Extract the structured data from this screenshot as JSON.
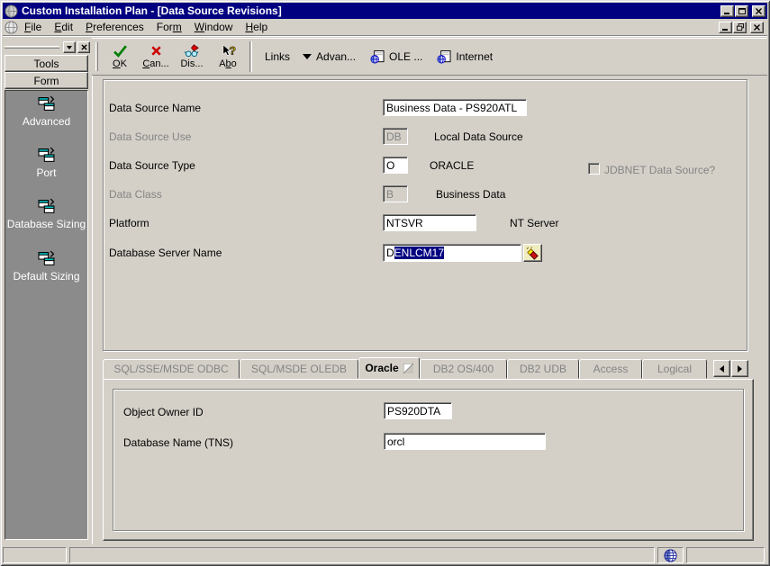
{
  "window": {
    "title": "Custom Installation Plan - [Data Source Revisions]"
  },
  "menu": {
    "items": [
      {
        "pre": "",
        "key": "F",
        "post": "ile"
      },
      {
        "pre": "",
        "key": "E",
        "post": "dit"
      },
      {
        "pre": "",
        "key": "P",
        "post": "references"
      },
      {
        "pre": "For",
        "key": "m",
        "post": ""
      },
      {
        "pre": "",
        "key": "W",
        "post": "indow"
      },
      {
        "pre": "",
        "key": "H",
        "post": "elp"
      }
    ]
  },
  "toolbar": {
    "ok": {
      "pre": "",
      "key": "O",
      "post": "K"
    },
    "cancel": {
      "pre": "",
      "key": "C",
      "post": "an..."
    },
    "display": {
      "pre": "Dis...",
      "key": "",
      "post": ""
    },
    "about": {
      "pre": "A",
      "key": "b",
      "post": "o"
    },
    "links_label": "Links",
    "advanced_label": "Advan...",
    "ole_label": "OLE ...",
    "internet_label": "Internet"
  },
  "sidebar": {
    "tabs": [
      {
        "label": "Tools"
      },
      {
        "label": "Form"
      }
    ],
    "items": [
      {
        "label": "Advanced"
      },
      {
        "label": "Port"
      },
      {
        "label": "Database Sizing"
      },
      {
        "label": "Default Sizing"
      }
    ]
  },
  "form": {
    "data_source_name": {
      "label": "Data Source Name",
      "value": "Business Data - PS920ATL"
    },
    "data_source_use": {
      "label": "Data Source Use",
      "value": "DB",
      "desc": "Local Data Source",
      "disabled": true
    },
    "data_source_type": {
      "label": "Data Source Type",
      "value": "O",
      "desc": "ORACLE"
    },
    "jdbnet": {
      "label": "JDBNET Data Source?",
      "checked": false
    },
    "data_class": {
      "label": "Data Class",
      "value": "B",
      "desc": "Business Data",
      "disabled": true
    },
    "platform": {
      "label": "Platform",
      "value": "NTSVR",
      "desc": "NT Server"
    },
    "database_server": {
      "label": "Database Server Name",
      "value": "DENLCM17",
      "unselected_part": "D",
      "selected_part": "ENLCM17"
    }
  },
  "tab_strip": {
    "active": "Oracle",
    "tabs": [
      {
        "label": "SQL/SSE/MSDE ODBC"
      },
      {
        "label": "SQL/MSDE OLEDB"
      },
      {
        "label": "Oracle"
      },
      {
        "label": "DB2 OS/400"
      },
      {
        "label": "DB2 UDB"
      },
      {
        "label": "Access"
      },
      {
        "label": "Logical"
      }
    ]
  },
  "oracle_tab": {
    "object_owner_id": {
      "label": "Object Owner ID",
      "value": "PS920DTA"
    },
    "database_name_tns": {
      "label": "Database Name (TNS)",
      "value": "orcl"
    }
  },
  "colors": {
    "titlebar": "#000080",
    "selection": "#000080",
    "window_bg": "#d4d0c8",
    "sidebar_panel": "#8b8b8b",
    "check_green": "#008000",
    "cancel_red": "#cc0000",
    "icon_teal": "#00b8b8"
  }
}
